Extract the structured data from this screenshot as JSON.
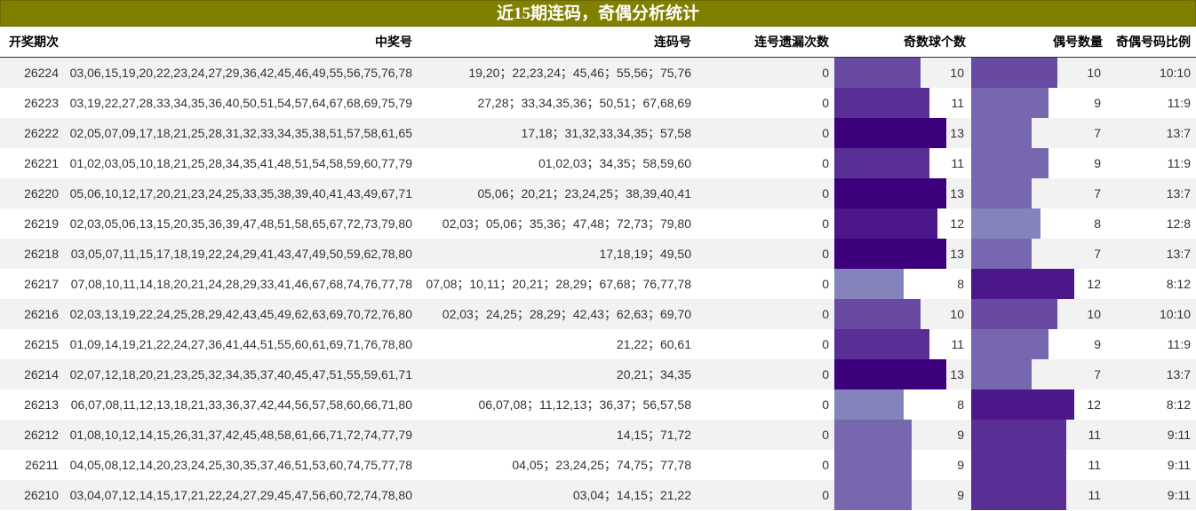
{
  "title": "近15期连码，奇偶分析统计",
  "headers": {
    "issue": "开奖期次",
    "numbers": "中奖号",
    "consec": "连码号",
    "miss": "连号遗漏次数",
    "odd": "奇数球个数",
    "even": "偶号数量",
    "ratio": "奇偶号码比例"
  },
  "bar_colors": {
    "8": "#8583bc",
    "9": "#7667ae",
    "10": "#684aa2",
    "11": "#5a2f95",
    "12": "#4b1789",
    "13": "#3d007d"
  },
  "rows": [
    {
      "issue": "26224",
      "numbers": "03,06,15,19,20,22,23,24,27,29,36,42,45,46,49,55,56,75,76,78",
      "consec": "19,20；22,23,24；45,46；55,56；75,76",
      "miss": "0",
      "odd": "10",
      "even": "10",
      "ratio": "10:10"
    },
    {
      "issue": "26223",
      "numbers": "03,19,22,27,28,33,34,35,36,40,50,51,54,57,64,67,68,69,75,79",
      "consec": "27,28；33,34,35,36；50,51；67,68,69",
      "miss": "0",
      "odd": "11",
      "even": "9",
      "ratio": "11:9"
    },
    {
      "issue": "26222",
      "numbers": "02,05,07,09,17,18,21,25,28,31,32,33,34,35,38,51,57,58,61,65",
      "consec": "17,18；31,32,33,34,35；57,58",
      "miss": "0",
      "odd": "13",
      "even": "7",
      "ratio": "13:7"
    },
    {
      "issue": "26221",
      "numbers": "01,02,03,05,10,18,21,25,28,34,35,41,48,51,54,58,59,60,77,79",
      "consec": "01,02,03；34,35；58,59,60",
      "miss": "0",
      "odd": "11",
      "even": "9",
      "ratio": "11:9"
    },
    {
      "issue": "26220",
      "numbers": "05,06,10,12,17,20,21,23,24,25,33,35,38,39,40,41,43,49,67,71",
      "consec": "05,06；20,21；23,24,25；38,39,40,41",
      "miss": "0",
      "odd": "13",
      "even": "7",
      "ratio": "13:7"
    },
    {
      "issue": "26219",
      "numbers": "02,03,05,06,13,15,20,35,36,39,47,48,51,58,65,67,72,73,79,80",
      "consec": "02,03；05,06；35,36；47,48；72,73；79,80",
      "miss": "0",
      "odd": "12",
      "even": "8",
      "ratio": "12:8"
    },
    {
      "issue": "26218",
      "numbers": "03,05,07,11,15,17,18,19,22,24,29,41,43,47,49,50,59,62,78,80",
      "consec": "17,18,19；49,50",
      "miss": "0",
      "odd": "13",
      "even": "7",
      "ratio": "13:7"
    },
    {
      "issue": "26217",
      "numbers": "07,08,10,11,14,18,20,21,24,28,29,33,41,46,67,68,74,76,77,78",
      "consec": "07,08；10,11；20,21；28,29；67,68；76,77,78",
      "miss": "0",
      "odd": "8",
      "even": "12",
      "ratio": "8:12"
    },
    {
      "issue": "26216",
      "numbers": "02,03,13,19,22,24,25,28,29,42,43,45,49,62,63,69,70,72,76,80",
      "consec": "02,03；24,25；28,29；42,43；62,63；69,70",
      "miss": "0",
      "odd": "10",
      "even": "10",
      "ratio": "10:10"
    },
    {
      "issue": "26215",
      "numbers": "01,09,14,19,21,22,24,27,36,41,44,51,55,60,61,69,71,76,78,80",
      "consec": "21,22；60,61",
      "miss": "0",
      "odd": "11",
      "even": "9",
      "ratio": "11:9"
    },
    {
      "issue": "26214",
      "numbers": "02,07,12,18,20,21,23,25,32,34,35,37,40,45,47,51,55,59,61,71",
      "consec": "20,21；34,35",
      "miss": "0",
      "odd": "13",
      "even": "7",
      "ratio": "13:7"
    },
    {
      "issue": "26213",
      "numbers": "06,07,08,11,12,13,18,21,33,36,37,42,44,56,57,58,60,66,71,80",
      "consec": "06,07,08；11,12,13；36,37；56,57,58",
      "miss": "0",
      "odd": "8",
      "even": "12",
      "ratio": "8:12"
    },
    {
      "issue": "26212",
      "numbers": "01,08,10,12,14,15,26,31,37,42,45,48,58,61,66,71,72,74,77,79",
      "consec": "14,15；71,72",
      "miss": "0",
      "odd": "9",
      "even": "11",
      "ratio": "9:11"
    },
    {
      "issue": "26211",
      "numbers": "04,05,08,12,14,20,23,24,25,30,35,37,46,51,53,60,74,75,77,78",
      "consec": "04,05；23,24,25；74,75；77,78",
      "miss": "0",
      "odd": "9",
      "even": "11",
      "ratio": "9:11"
    },
    {
      "issue": "26210",
      "numbers": "03,04,07,12,14,15,17,21,22,24,27,29,45,47,56,60,72,74,78,80",
      "consec": "03,04；14,15；21,22",
      "miss": "0",
      "odd": "9",
      "even": "11",
      "ratio": "9:11"
    }
  ]
}
